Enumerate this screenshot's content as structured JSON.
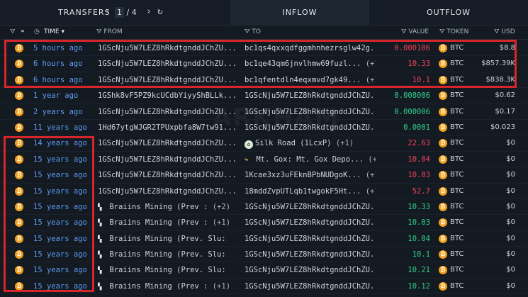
{
  "topbar": {
    "transfers_label": "TRANSFERS",
    "prev_icon": "chevron-left-icon",
    "page_current": "1",
    "page_sep": "/",
    "page_total": "4",
    "next_icon": "chevron-right-icon",
    "refresh_icon": "refresh-icon",
    "inflow_label": "INFLOW",
    "outflow_label": "OUTFLOW"
  },
  "columns": {
    "time": "TIME",
    "from": "FROM",
    "to": "TO",
    "value": "VALUE",
    "token": "TOKEN",
    "usd": "USD"
  },
  "watermark": "ARKHAM",
  "colors": {
    "red": "#f0435a",
    "green": "#2fd089",
    "link": "#5b9cf3",
    "btc": "#f2a01a",
    "highlight": "#d6262b"
  },
  "rows": [
    {
      "time": "5 hours ago",
      "from": "1GScNju5W7LEZ8hRkdtgnddJChZU...",
      "to": "bc1qs4qxxqdfggmhnhezrsglw42g...",
      "to_plus": "",
      "value": "0.000106",
      "dir": "out",
      "token": "BTC",
      "usd": "$8.8"
    },
    {
      "time": "6 hours ago",
      "from": "1GScNju5W7LEZ8hRkdtgnddJChZU...",
      "to": "bc1qe43qm6jnvlhmw69fuzl...",
      "to_plus": "(+1)",
      "value": "10.33",
      "dir": "out",
      "token": "BTC",
      "usd": "$857.39K"
    },
    {
      "time": "6 hours ago",
      "from": "1GScNju5W7LEZ8hRkdtgnddJChZU...",
      "to": "bc1qfentdln4eqxmvd7gk49...",
      "to_plus": "(+1)",
      "value": "10.1",
      "dir": "out",
      "token": "BTC",
      "usd": "$838.3K"
    },
    {
      "time": "1 year ago",
      "from": "1GShk8vF5PZ9kcUCdbYiyyShBLLk...",
      "to": "1GScNju5W7LEZ8hRkdtgnddJChZU...",
      "to_plus": "",
      "value": "0.008006",
      "dir": "in",
      "token": "BTC",
      "usd": "$0.62"
    },
    {
      "time": "2 years ago",
      "from": "1GScNju5W7LEZ8hRkdtgnddJChZU...",
      "to": "1GScNju5W7LEZ8hRkdtgnddJChZU...",
      "to_plus": "",
      "value": "0.000006",
      "dir": "in",
      "token": "BTC",
      "usd": "$0.17"
    },
    {
      "time": "11 years ago",
      "from": "1Hd67ytgWJGR2TPUxpbfa8W7tw91...",
      "to": "1GScNju5W7LEZ8hRkdtgnddJChZU...",
      "to_plus": "",
      "value": "0.0001",
      "dir": "in",
      "token": "BTC",
      "usd": "$0.023"
    },
    {
      "time": "14 years ago",
      "from": "1GScNju5W7LEZ8hRkdtgnddJChZU...",
      "to": "Silk Road (1LcxP)",
      "to_plus": "(+1)",
      "to_icon": "silk",
      "value": "22.63",
      "dir": "out",
      "token": "BTC",
      "usd": "$0"
    },
    {
      "time": "15 years ago",
      "from": "1GScNju5W7LEZ8hRkdtgnddJChZU...",
      "to": "Mt. Gox: Mt. Gox Depo...",
      "to_plus": "(+1)",
      "to_icon": "gox",
      "value": "10.04",
      "dir": "out",
      "token": "BTC",
      "usd": "$0"
    },
    {
      "time": "15 years ago",
      "from": "1GScNju5W7LEZ8hRkdtgnddJChZU...",
      "to": "1Kcae3xz3uFEknBPbNUDgoK...",
      "to_plus": "(+1)",
      "value": "10.03",
      "dir": "out",
      "token": "BTC",
      "usd": "$0"
    },
    {
      "time": "15 years ago",
      "from": "1GScNju5W7LEZ8hRkdtgnddJChZU...",
      "to": "18mddZvpUTLqb1twgokF5Ht...",
      "to_plus": "(+1)",
      "value": "52.7",
      "dir": "out",
      "token": "BTC",
      "usd": "$0"
    },
    {
      "time": "15 years ago",
      "from": "Braiins Mining (Prev :",
      "from_plus": "(+2)",
      "from_icon": true,
      "to": "1GScNju5W7LEZ8hRkdtgnddJChZU...",
      "to_plus": "",
      "value": "10.33",
      "dir": "in",
      "token": "BTC",
      "usd": "$0"
    },
    {
      "time": "15 years ago",
      "from": "Braiins Mining (Prev :",
      "from_plus": "(+1)",
      "from_icon": true,
      "to": "1GScNju5W7LEZ8hRkdtgnddJChZU...",
      "to_plus": "",
      "value": "10.03",
      "dir": "in",
      "token": "BTC",
      "usd": "$0"
    },
    {
      "time": "15 years ago",
      "from": "Braiins Mining (Prev. Slu:",
      "from_plus": "",
      "from_icon": true,
      "to": "1GScNju5W7LEZ8hRkdtgnddJChZU...",
      "to_plus": "",
      "value": "10.04",
      "dir": "in",
      "token": "BTC",
      "usd": "$0"
    },
    {
      "time": "15 years ago",
      "from": "Braiins Mining (Prev. Slu:",
      "from_plus": "",
      "from_icon": true,
      "to": "1GScNju5W7LEZ8hRkdtgnddJChZU...",
      "to_plus": "",
      "value": "10.1",
      "dir": "in",
      "token": "BTC",
      "usd": "$0"
    },
    {
      "time": "15 years ago",
      "from": "Braiins Mining (Prev. Slu:",
      "from_plus": "",
      "from_icon": true,
      "to": "1GScNju5W7LEZ8hRkdtgnddJChZU...",
      "to_plus": "",
      "value": "10.21",
      "dir": "in",
      "token": "BTC",
      "usd": "$0"
    },
    {
      "time": "15 years ago",
      "from": "Braiins Mining (Prev :",
      "from_plus": "(+1)",
      "from_icon": true,
      "to": "1GScNju5W7LEZ8hRkdtgnddJChZU...",
      "to_plus": "",
      "value": "10.12",
      "dir": "in",
      "token": "BTC",
      "usd": "$0"
    }
  ]
}
